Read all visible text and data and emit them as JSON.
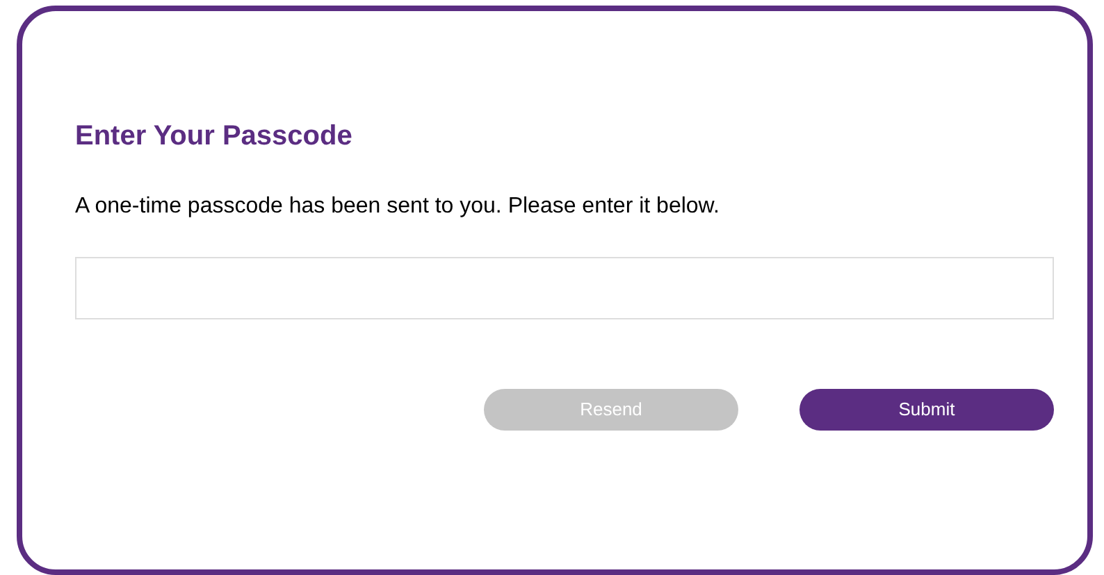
{
  "title": "Enter Your Passcode",
  "message": "A one-time passcode has been sent to you. Please enter it below.",
  "buttons": [
    {
      "label": "Resend",
      "disabled": true
    },
    {
      "label": "Submit",
      "disabled": false
    }
  ]
}
